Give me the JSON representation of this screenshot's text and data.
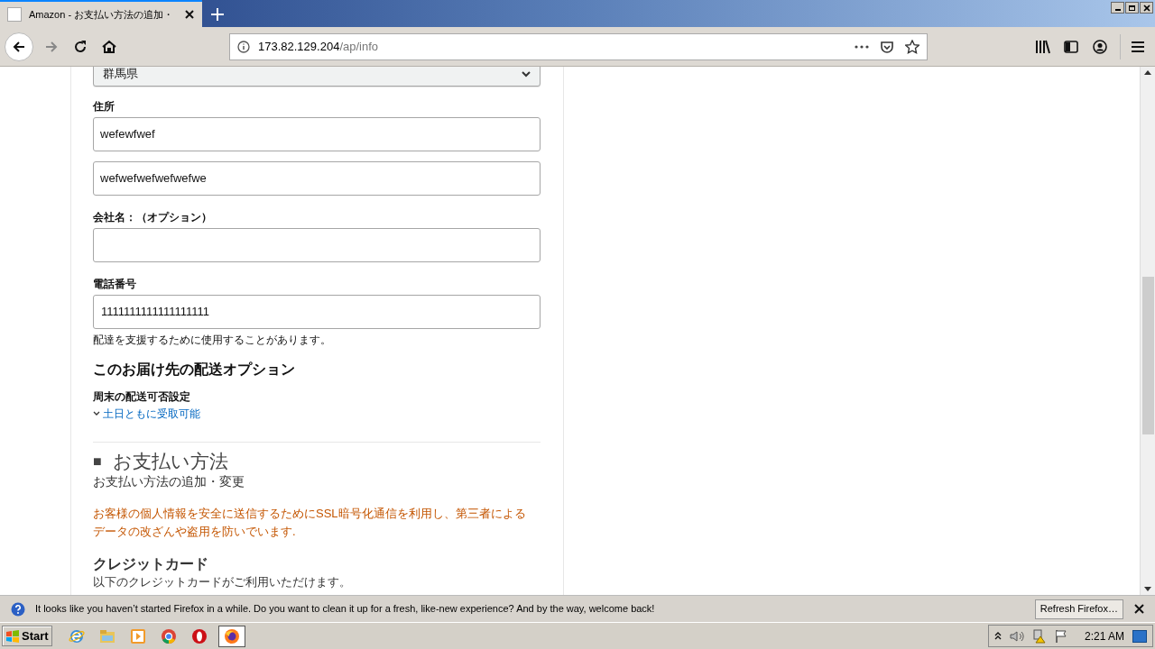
{
  "browser": {
    "tab": {
      "title": "Amazon - お支払い方法の追加・",
      "selected": true
    },
    "url": {
      "host": "173.82.129.204",
      "path": "/ap/info"
    }
  },
  "form": {
    "state_select": {
      "value": "群馬県"
    },
    "address": {
      "label": "住所",
      "lines": [
        "wefewfwef",
        "wefwefwefwefwefwe"
      ]
    },
    "company": {
      "label": "会社名：（オプション）"
    },
    "phone": {
      "label": "電話番号",
      "value": "1111111111111111111",
      "hint": "配達を支援するために使用することがあります。"
    },
    "delivery_options": {
      "heading": "このお届け先の配送オプション",
      "subheading": "周末の配送可否設定",
      "link": "土日ともに受取可能",
      "expanded": false
    }
  },
  "payment": {
    "bullet": "■",
    "heading": "お支払い方法",
    "subheading": "お支払い方法の追加・変更",
    "notice": "お客様の個人情報を安全に送信するためにSSL暗号化通信を利用し、第三者によるデータの改ざんや盗用を防いでいます.",
    "card_heading": "クレジットカード",
    "card_text": "以下のクレジットカードがご利用いただけます。"
  },
  "notification": {
    "message": "It looks like you haven’t started Firefox in a while. Do you want to clean it up for a fresh, like-new experience? And by the way, welcome back!",
    "button": "Refresh Firefox…"
  },
  "taskbar": {
    "start": "Start",
    "apps": [
      {
        "kind": "ie",
        "selected": false
      },
      {
        "kind": "explorer",
        "selected": false
      },
      {
        "kind": "media",
        "selected": false
      },
      {
        "kind": "chrome",
        "selected": false
      },
      {
        "kind": "opera",
        "selected": false
      },
      {
        "kind": "firefox",
        "selected": true
      }
    ],
    "clock": "2:21 AM"
  }
}
